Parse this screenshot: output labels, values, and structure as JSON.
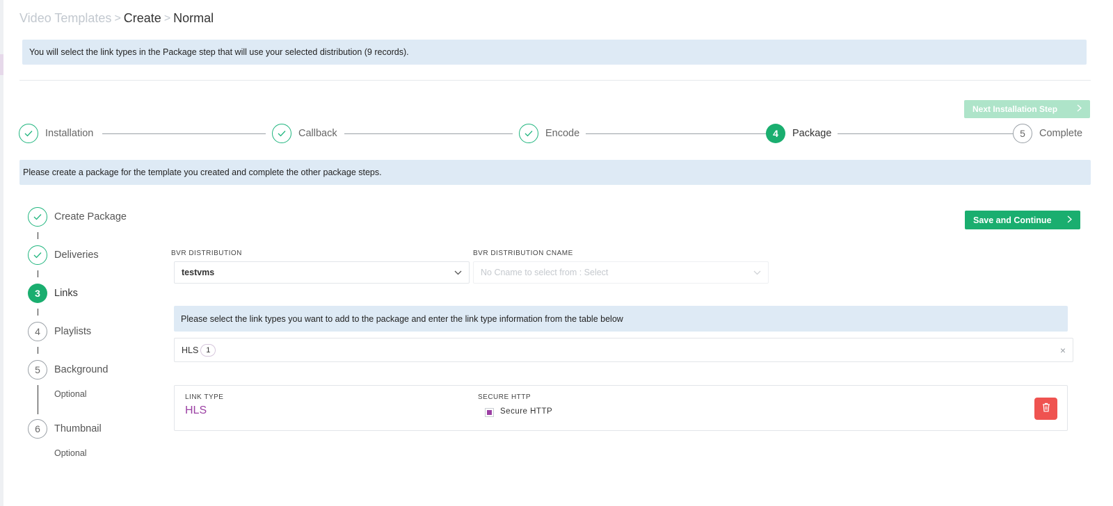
{
  "breadcrumb": {
    "items": [
      "Video Templates",
      "Create",
      "Normal"
    ],
    "separator": ">"
  },
  "info": {
    "top": "You will select the link types in the Package step that will use your selected distribution (9 records).",
    "package": "Please create a package for the template you created and complete the other package steps.",
    "links": "Please select the link types you want to add to the package and enter the link type information from the table below"
  },
  "buttons": {
    "next_step": "Next Installation Step",
    "save_continue": "Save and Continue",
    "chevron": ">"
  },
  "stepper": {
    "steps": [
      {
        "label": "Installation",
        "state": "done",
        "number": ""
      },
      {
        "label": "Callback",
        "state": "done",
        "number": ""
      },
      {
        "label": "Encode",
        "state": "done",
        "number": ""
      },
      {
        "label": "Package",
        "state": "active",
        "number": "4"
      },
      {
        "label": "Complete",
        "state": "todo",
        "number": "5"
      }
    ]
  },
  "substeps": {
    "items": [
      {
        "label": "Create Package",
        "state": "done",
        "number": ""
      },
      {
        "label": "Deliveries",
        "state": "done",
        "number": ""
      },
      {
        "label": "Links",
        "state": "active",
        "number": "3"
      },
      {
        "label": "Playlists",
        "state": "todo",
        "number": "4"
      },
      {
        "label": "Background",
        "state": "todo",
        "number": "5",
        "optional": "Optional"
      },
      {
        "label": "Thumbnail",
        "state": "todo",
        "number": "6",
        "optional": "Optional"
      }
    ]
  },
  "form": {
    "distribution_label": "BVR DISTRIBUTION",
    "distribution_value": "testvms",
    "cname_label": "BVR DISTRIBUTION CNAME",
    "cname_placeholder": "No Cname to select from : Select"
  },
  "tags": {
    "selected": [
      {
        "label": "HLS",
        "count": "1"
      }
    ],
    "clear_icon": "×"
  },
  "link_table": {
    "col_link_type": "LINK TYPE",
    "col_secure": "SECURE HTTP",
    "rows": [
      {
        "link_type": "HLS",
        "secure_label": "Secure HTTP",
        "secure_checked": true
      }
    ]
  },
  "colors": {
    "accent_green": "#1aae6f",
    "accent_purple": "#9b3fa3",
    "danger": "#ef5350",
    "info_bg": "#deeaf5"
  },
  "icons": {
    "done": "check-icon",
    "chevron": "chevron-right-icon",
    "select_arrow": "chevron-down-icon",
    "delete": "trash-icon"
  }
}
